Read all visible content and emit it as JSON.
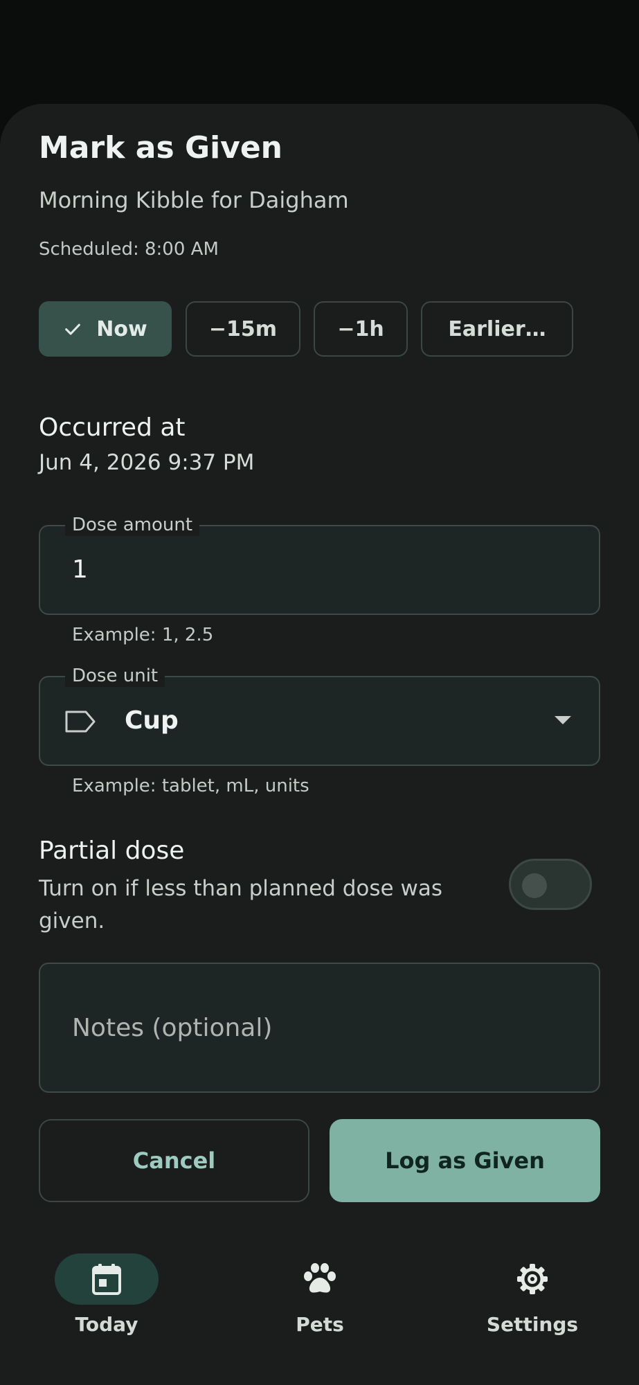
{
  "sheet": {
    "title": "Mark as Given",
    "subtitle": "Morning Kibble for Daigham",
    "scheduled": "Scheduled: 8:00 AM"
  },
  "time_chips": [
    {
      "label": "Now",
      "selected": true
    },
    {
      "label": "−15m",
      "selected": false
    },
    {
      "label": "−1h",
      "selected": false
    },
    {
      "label": "Earlier…",
      "selected": false
    }
  ],
  "occurred": {
    "label": "Occurred at",
    "value": "Jun 4, 2026 9:37 PM"
  },
  "dose_amount": {
    "label": "Dose amount",
    "value": "1",
    "helper": "Example: 1, 2.5"
  },
  "dose_unit": {
    "label": "Dose unit",
    "value": "Cup",
    "helper": "Example: tablet, mL, units",
    "icon": "label-tag-icon"
  },
  "partial_dose": {
    "title": "Partial dose",
    "description": "Turn on if less than planned dose was given.",
    "enabled": false
  },
  "notes": {
    "placeholder": "Notes (optional)"
  },
  "actions": {
    "cancel": "Cancel",
    "confirm": "Log as Given"
  },
  "nav": {
    "items": [
      {
        "label": "Today",
        "icon": "calendar-icon",
        "active": true
      },
      {
        "label": "Pets",
        "icon": "paw-icon",
        "active": false
      },
      {
        "label": "Settings",
        "icon": "gear-icon",
        "active": false
      }
    ]
  },
  "colors": {
    "accent": "#7fb2a2",
    "selected_chip": "#37524b",
    "surface": "#1a1d1c",
    "backdrop": "#0a0d0c"
  }
}
